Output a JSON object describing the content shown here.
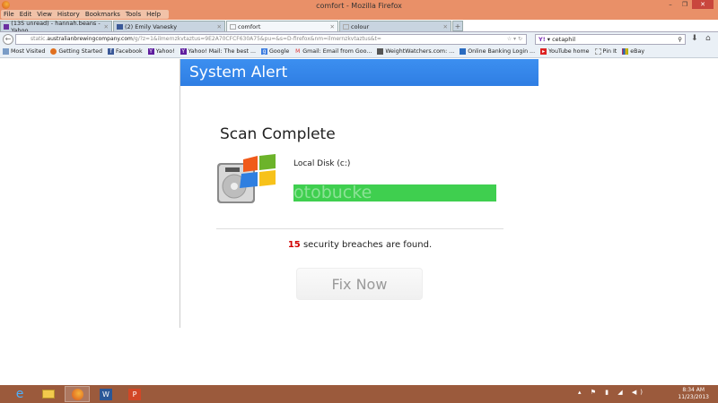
{
  "window": {
    "title": "comfort - Mozilla Firefox",
    "min": "–",
    "max": "❐",
    "close": "✕"
  },
  "menu": [
    "File",
    "Edit",
    "View",
    "History",
    "Bookmarks",
    "Tools",
    "Help"
  ],
  "tabs": [
    {
      "label": "(135 unread) - hannah.beans - Yahoo..."
    },
    {
      "label": "(2) Emily Vanesky"
    },
    {
      "label": "comfort"
    },
    {
      "label": "colour"
    }
  ],
  "new_tab": "+",
  "nav": {
    "url_prefix": "static.",
    "url_domain": "australianbrewingcompany.com",
    "url_rest": "/g/?z=1&ilmernzkvtaztus=9E2A70CFCF630A75&pu=&s=D-firefox&nm=ilmernzkvtaztus&t=",
    "search_value": "cetaphil",
    "search_engine": "Y!"
  },
  "bookmarks": [
    "Most Visited",
    "Getting Started",
    "Facebook",
    "Yahoo!",
    "Yahoo! Mail: The best ...",
    "Google",
    "Gmail: Email from Goo...",
    "WeightWatchers.com: ...",
    "Online Banking Login ...",
    "YouTube home",
    "Pin It",
    "eBay"
  ],
  "alert": {
    "header": "System Alert",
    "scan_title": "Scan Complete",
    "disk_label": "Local Disk (c:)",
    "progress_percent": 100,
    "watermark": "otobucke",
    "breach_count": "15",
    "breach_text": " security breaches are found.",
    "fix_button": "Fix Now"
  },
  "taskbar": {
    "time": "8:34 AM",
    "date": "11/23/2013",
    "apps": [
      "ie",
      "explorer",
      "firefox",
      "word",
      "powerpoint"
    ]
  },
  "colors": {
    "titlebar": "#e99068",
    "alert_header": "#3c8ff0",
    "progress": "#3fcf4f",
    "breach": "#d10000",
    "taskbar": "#9b5a3c"
  }
}
